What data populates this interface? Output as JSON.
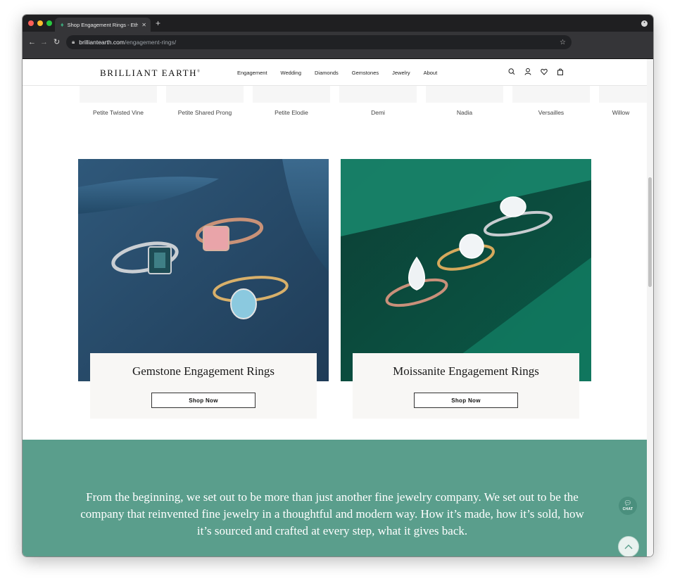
{
  "browser": {
    "tab_title": "Shop Engagement Rings - Eth",
    "url_host": "brilliantearth.com",
    "url_path": "/engagement-rings/"
  },
  "header": {
    "logo": "BRILLIANT EARTH",
    "logo_mark": "®",
    "nav": [
      "Engagement",
      "Wedding",
      "Diamonds",
      "Gemstones",
      "Jewelry",
      "About"
    ]
  },
  "carousel": {
    "items": [
      "Petite Twisted Vine",
      "Petite Shared Prong",
      "Petite Elodie",
      "Demi",
      "Nadia",
      "Versailles",
      "Willow"
    ]
  },
  "features": [
    {
      "title": "Gemstone Engagement Rings",
      "button": "Shop Now"
    },
    {
      "title": "Moissanite Engagement Rings",
      "button": "Shop Now"
    }
  ],
  "mission": {
    "text": "From the beginning, we set out to be more than just another fine jewelry company. We set out to be the company that reinvented fine jewelry in a thoughtful and modern way. How it’s made, how it’s sold, how it’s sourced and crafted at every step, what it gives back."
  },
  "chat": {
    "label": "CHAT"
  },
  "colors": {
    "mission_bg": "#5a9e8c",
    "gemstone_bg": "#2c5170",
    "moissanite_bg": "#0f6a55",
    "browser_chrome": "#353538"
  }
}
